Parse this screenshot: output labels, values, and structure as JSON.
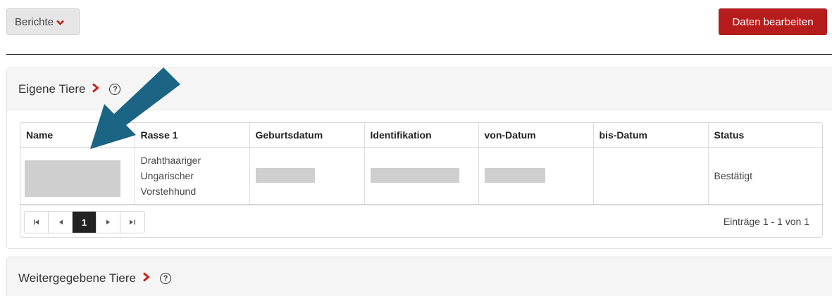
{
  "toolbar": {
    "reports_label": "Berichte",
    "edit_label": "Daten bearbeiten",
    "accent_color": "#b71c1c"
  },
  "own_animals": {
    "title": "Eigene Tiere",
    "columns": [
      "Name",
      "Rasse 1",
      "Geburtsdatum",
      "Identifikation",
      "von-Datum",
      "bis-Datum",
      "Status"
    ],
    "rows": [
      {
        "rasse_lines": [
          "Drahthaariger",
          "Ungarischer",
          "Vorstehhund"
        ],
        "status": "Bestätigt"
      }
    ],
    "pager": {
      "current_page": "1",
      "info": "Einträge 1 - 1 von 1"
    }
  },
  "transferred_animals": {
    "title": "Weitergegebene Tiere"
  },
  "annotation_arrow_color": "#1b6483"
}
